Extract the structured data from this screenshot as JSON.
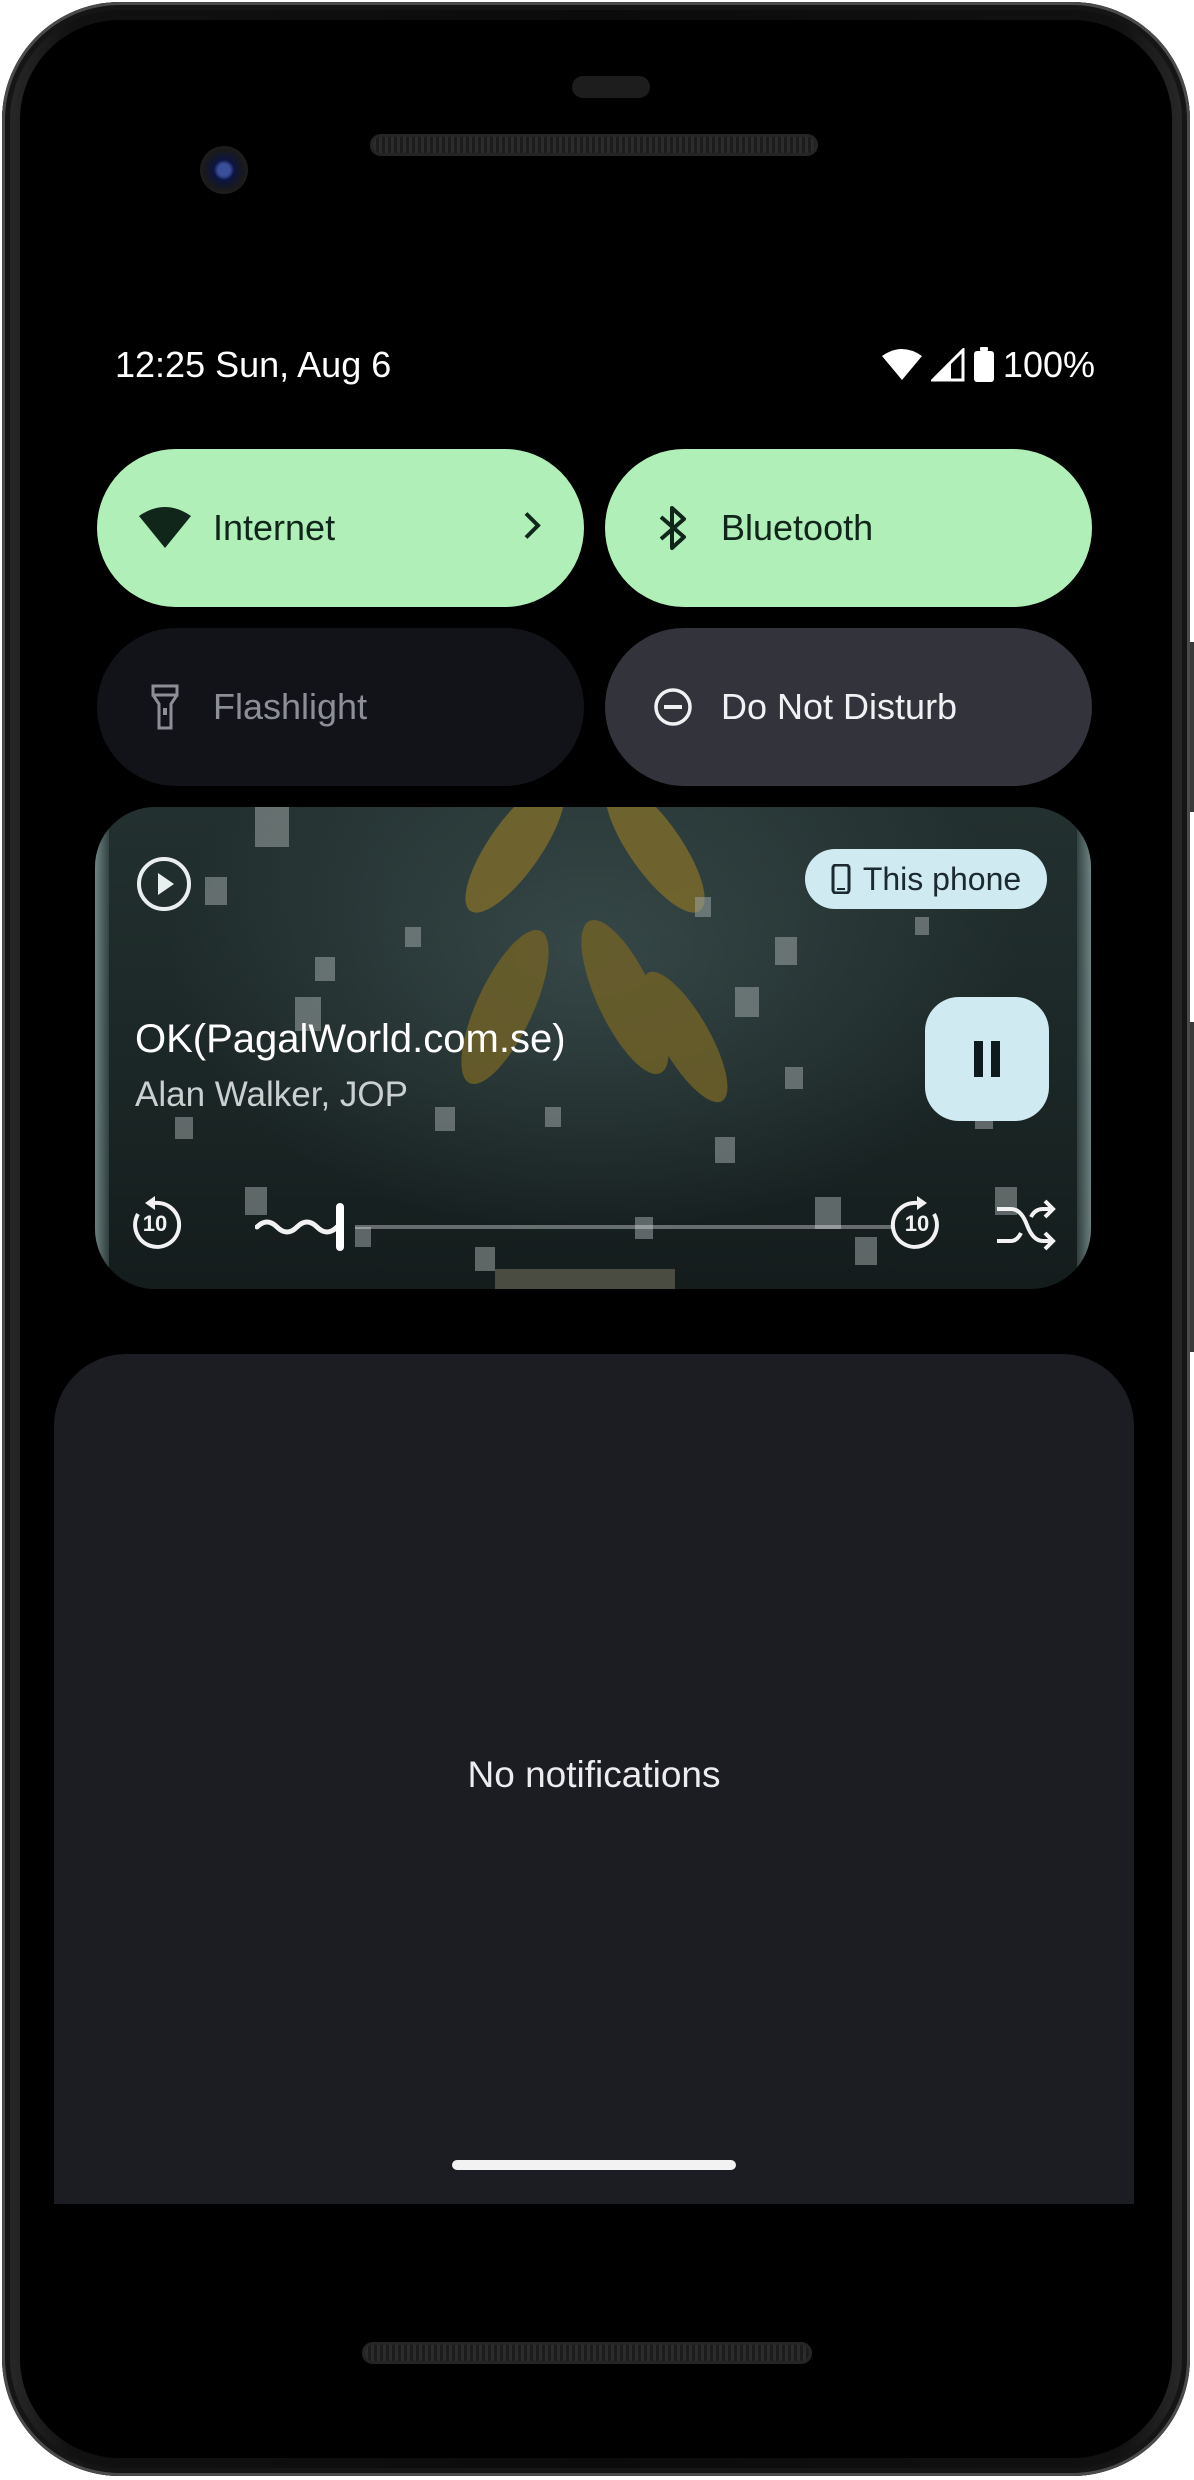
{
  "status_bar": {
    "time_date": "12:25 Sun, Aug 6",
    "battery": "100%",
    "icons": [
      "wifi-icon",
      "cell-signal-icon",
      "battery-icon"
    ]
  },
  "quick_settings": {
    "tiles": [
      {
        "label": "Internet",
        "icon": "wifi-icon",
        "state": "on"
      },
      {
        "label": "Bluetooth",
        "icon": "bluetooth-icon",
        "state": "on"
      },
      {
        "label": "Flashlight",
        "icon": "flashlight-icon",
        "state": "unavailable"
      },
      {
        "label": "Do Not Disturb",
        "icon": "dnd-icon",
        "state": "off"
      }
    ]
  },
  "media": {
    "app_icon": "play-circle-icon",
    "output_device": "This phone",
    "title": "OK(PagalWorld.com.se)",
    "artist": "Alan Walker, JOP",
    "state": "playing",
    "rewind_label": "10",
    "forward_label": "10",
    "progress": 0.16
  },
  "notifications": {
    "empty_text": "No notifications"
  },
  "colors": {
    "tile_on": "#b0efb7",
    "tile_off": "#121318",
    "tile_mid": "#33343b",
    "chip": "#cfeaf1",
    "panel": "#1c1c23"
  }
}
